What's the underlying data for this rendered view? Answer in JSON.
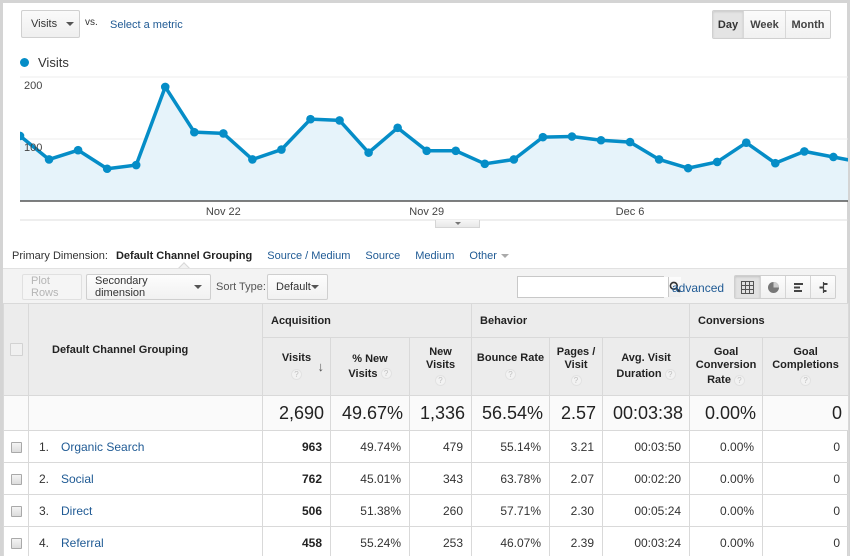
{
  "metric_selector": {
    "selected": "Visits",
    "vs_label": "vs.",
    "compare_link": "Select a metric"
  },
  "period_toggle": {
    "options": [
      "Day",
      "Week",
      "Month"
    ],
    "active": "Day"
  },
  "legend": {
    "series_label": "Visits",
    "color": "#058dc7"
  },
  "chart_data": {
    "type": "area",
    "title": "",
    "xlabel": "",
    "ylabel": "",
    "series": [
      {
        "name": "Visits",
        "color": "#058dc7",
        "values": [
          105,
          67,
          82,
          52,
          58,
          184,
          111,
          109,
          67,
          83,
          132,
          130,
          78,
          118,
          81,
          81,
          60,
          67,
          103,
          104,
          98,
          95,
          67,
          53,
          63,
          94,
          61,
          80,
          71,
          62
        ]
      }
    ],
    "x_tick_labels": [
      {
        "index": 7,
        "label": "Nov 22"
      },
      {
        "index": 14,
        "label": "Nov 29"
      },
      {
        "index": 21,
        "label": "Dec 6"
      }
    ],
    "y_tick_labels": [
      {
        "value": 100,
        "label": "100"
      },
      {
        "value": 200,
        "label": "200"
      }
    ],
    "ylim": [
      0,
      200
    ],
    "grid": true
  },
  "primary_dimension": {
    "label": "Primary Dimension:",
    "current": "Default Channel Grouping",
    "options": [
      "Source / Medium",
      "Source",
      "Medium"
    ],
    "other": "Other"
  },
  "toolbar": {
    "plot_rows": "Plot Rows",
    "secondary_dimension": "Secondary dimension",
    "sort_type_label": "Sort Type:",
    "sort_type_value": "Default",
    "search_value": "",
    "advanced": "advanced",
    "view_icons": [
      "table-view-icon",
      "pie-view-icon",
      "performance-view-icon",
      "comparison-view-icon"
    ]
  },
  "table": {
    "dimension_header": "Default Channel Grouping",
    "groups": [
      "Acquisition",
      "Behavior",
      "Conversions"
    ],
    "columns": [
      {
        "l1": "Visits",
        "l2": ""
      },
      {
        "l1": "% New",
        "l2": "Visits"
      },
      {
        "l1": "New",
        "l2": "Visits"
      },
      {
        "l1": "Bounce Rate",
        "l2": ""
      },
      {
        "l1": "Pages /",
        "l2": "Visit"
      },
      {
        "l1": "Avg. Visit",
        "l2": "Duration"
      },
      {
        "l1": "Goal",
        "l2": "Conversion",
        "l3": "Rate"
      },
      {
        "l1": "Goal",
        "l2": "Completions"
      }
    ],
    "help_glyph": "?",
    "sort_glyph": "↓",
    "totals": [
      "2,690",
      "49.67%",
      "1,336",
      "56.54%",
      "2.57",
      "00:03:38",
      "0.00%",
      "0"
    ],
    "rows": [
      {
        "rank": "1.",
        "name": "Organic Search",
        "values": [
          "963",
          "49.74%",
          "479",
          "55.14%",
          "3.21",
          "00:03:50",
          "0.00%",
          "0"
        ]
      },
      {
        "rank": "2.",
        "name": "Social",
        "values": [
          "762",
          "45.01%",
          "343",
          "63.78%",
          "2.07",
          "00:02:20",
          "0.00%",
          "0"
        ]
      },
      {
        "rank": "3.",
        "name": "Direct",
        "values": [
          "506",
          "51.38%",
          "260",
          "57.71%",
          "2.30",
          "00:05:24",
          "0.00%",
          "0"
        ]
      },
      {
        "rank": "4.",
        "name": "Referral",
        "values": [
          "458",
          "55.24%",
          "253",
          "46.07%",
          "2.39",
          "00:03:24",
          "0.00%",
          "0"
        ]
      }
    ]
  }
}
